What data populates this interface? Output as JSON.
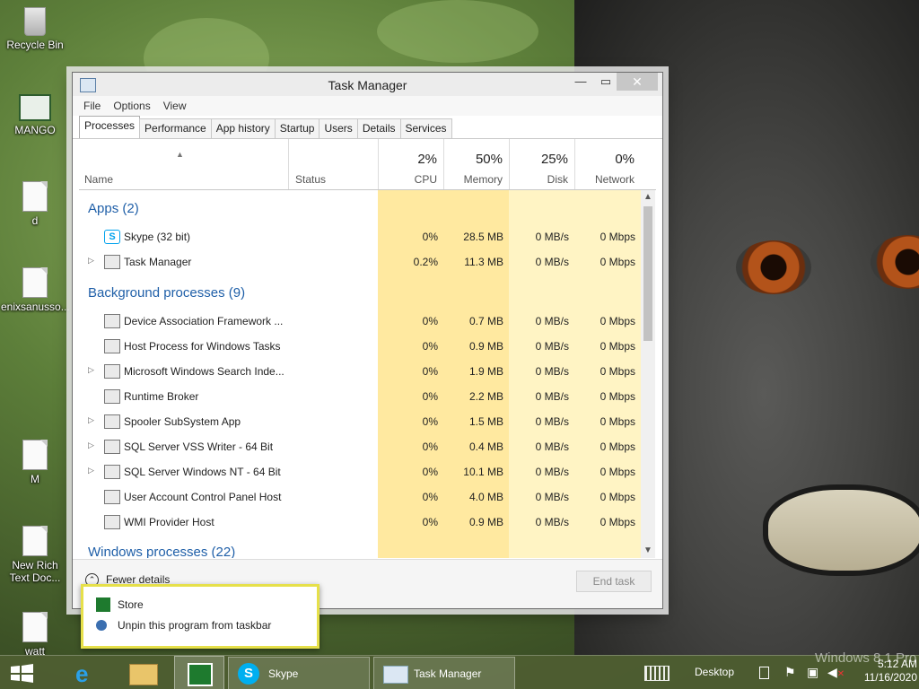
{
  "desktop": {
    "icons": [
      {
        "label": "Recycle Bin",
        "icon": "recycle-bin-icon"
      },
      {
        "label": "MANGO",
        "icon": "monitor-icon"
      },
      {
        "label": "d",
        "icon": "document-icon"
      },
      {
        "label": "enixsanusso...",
        "icon": "document-icon"
      },
      {
        "label": "M",
        "icon": "document-icon"
      },
      {
        "label": "New Rich Text Doc...",
        "icon": "rich-text-icon"
      },
      {
        "label": "watt",
        "icon": "document-icon"
      }
    ]
  },
  "window": {
    "title": "Task Manager",
    "controls": {
      "minimize": "—",
      "maximize": "▭",
      "close": "✕"
    },
    "menu": [
      "File",
      "Options",
      "View"
    ],
    "tabs": [
      "Processes",
      "Performance",
      "App history",
      "Startup",
      "Users",
      "Details",
      "Services"
    ],
    "active_tab": "Processes",
    "columns": {
      "name": "Name",
      "status": "Status",
      "cpu": {
        "pct": "2%",
        "label": "CPU"
      },
      "memory": {
        "pct": "50%",
        "label": "Memory"
      },
      "disk": {
        "pct": "25%",
        "label": "Disk"
      },
      "network": {
        "pct": "0%",
        "label": "Network"
      }
    },
    "groups": {
      "apps": "Apps (2)",
      "background": "Background processes (9)",
      "windows": "Windows processes (22)"
    },
    "apps": [
      {
        "name": "Skype (32 bit)",
        "icon": "skype-icon",
        "expandable": false,
        "cpu": "0%",
        "memory": "28.5 MB",
        "disk": "0 MB/s",
        "network": "0 Mbps"
      },
      {
        "name": "Task Manager",
        "icon": "task-manager-icon",
        "expandable": true,
        "cpu": "0.2%",
        "memory": "11.3 MB",
        "disk": "0 MB/s",
        "network": "0 Mbps"
      }
    ],
    "background": [
      {
        "name": "Device Association Framework ...",
        "icon": "service-icon",
        "expandable": false,
        "cpu": "0%",
        "memory": "0.7 MB",
        "disk": "0 MB/s",
        "network": "0 Mbps"
      },
      {
        "name": "Host Process for Windows Tasks",
        "icon": "service-icon",
        "expandable": false,
        "cpu": "0%",
        "memory": "0.9 MB",
        "disk": "0 MB/s",
        "network": "0 Mbps"
      },
      {
        "name": "Microsoft Windows Search Inde...",
        "icon": "search-indexer-icon",
        "expandable": true,
        "cpu": "0%",
        "memory": "1.9 MB",
        "disk": "0 MB/s",
        "network": "0 Mbps"
      },
      {
        "name": "Runtime Broker",
        "icon": "service-icon",
        "expandable": false,
        "cpu": "0%",
        "memory": "2.2 MB",
        "disk": "0 MB/s",
        "network": "0 Mbps"
      },
      {
        "name": "Spooler SubSystem App",
        "icon": "printer-icon",
        "expandable": true,
        "cpu": "0%",
        "memory": "1.5 MB",
        "disk": "0 MB/s",
        "network": "0 Mbps"
      },
      {
        "name": "SQL Server VSS Writer - 64 Bit",
        "icon": "service-icon",
        "expandable": true,
        "cpu": "0%",
        "memory": "0.4 MB",
        "disk": "0 MB/s",
        "network": "0 Mbps"
      },
      {
        "name": "SQL Server Windows NT - 64 Bit",
        "icon": "service-icon",
        "expandable": true,
        "cpu": "0%",
        "memory": "10.1 MB",
        "disk": "0 MB/s",
        "network": "0 Mbps"
      },
      {
        "name": "User Account Control Panel Host",
        "icon": "service-icon",
        "expandable": false,
        "cpu": "0%",
        "memory": "4.0 MB",
        "disk": "0 MB/s",
        "network": "0 Mbps"
      },
      {
        "name": "WMI Provider Host",
        "icon": "wmi-icon",
        "expandable": false,
        "cpu": "0%",
        "memory": "0.9 MB",
        "disk": "0 MB/s",
        "network": "0 Mbps"
      }
    ],
    "footer": {
      "fewer_details": "Fewer details",
      "end_task": "End task"
    }
  },
  "jumplist": {
    "items": [
      {
        "label": "Store",
        "icon": "store-icon"
      },
      {
        "label": "Unpin this program from taskbar",
        "icon": "unpin-icon"
      }
    ]
  },
  "taskbar": {
    "buttons": [
      {
        "label": "Skype",
        "icon": "skype-icon"
      },
      {
        "label": "Task Manager",
        "icon": "task-manager-icon"
      }
    ],
    "desktop_label": "Desktop",
    "watermark": "Windows 8.1 Pro",
    "time": "5:12 AM",
    "date": "11/16/2020"
  },
  "colors": {
    "heat": "#fff4c4",
    "heat_strong": "#ffe9a0",
    "group_text": "#1f5fa8",
    "jumplist_border": "#e6e04a"
  }
}
